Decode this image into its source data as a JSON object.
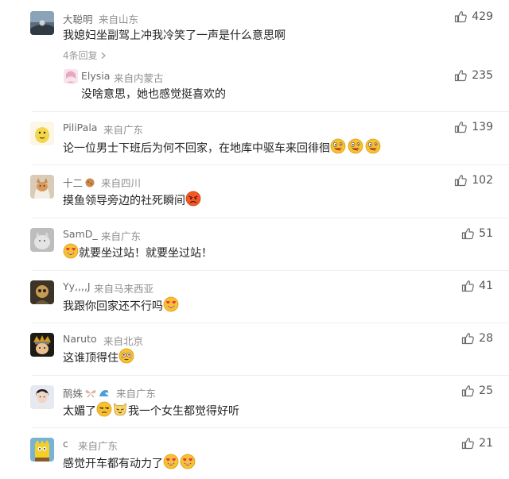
{
  "comments": [
    {
      "name": "大聪明",
      "location": "来自山东",
      "text": "我媳妇坐副驾上冲我冷笑了一声是什么意思啊",
      "likes": "429",
      "replies_label": "4条回复",
      "reply": {
        "name": "Elysia",
        "location": "来自内蒙古",
        "text": "没啥意思，她也感觉挺喜欢的",
        "likes": "235"
      }
    },
    {
      "name": "PiliPala",
      "location": "来自广东",
      "text": "论一位男士下班后为何不回家，在地库中驱车来回徘徊",
      "likes": "139"
    },
    {
      "name": "十二",
      "location": "来自四川",
      "text": "摸鱼领导旁边的社死瞬间",
      "likes": "102"
    },
    {
      "name": "SamD_",
      "location": "来自广东",
      "text": "就要坐过站！就要坐过站！",
      "likes": "51"
    },
    {
      "name": "Yy,,,,J",
      "location": "来自马来西亚",
      "text": "我跟你回家还不行吗",
      "likes": "41"
    },
    {
      "name": "Naruto",
      "location": "来自北京",
      "text": "这谁顶得住",
      "likes": "28"
    },
    {
      "name": "鸸姝",
      "location": "来自广东",
      "text_a": "太媚了",
      "text_b": "我一个女生都觉得好听",
      "likes": "25"
    },
    {
      "name": "c",
      "location": "来自广东",
      "text": "感觉开车都有动力了",
      "likes": "21"
    }
  ],
  "colors": {
    "name": "#6a6a6a",
    "text": "#222222",
    "meta": "#8f8f8f",
    "divider": "#efefef"
  },
  "icons": {
    "like": "thumb-up-icon",
    "chevron": "chevron-right-icon",
    "emoji_crazy": "zany-face-emoji",
    "emoji_angry": "angry-face-emoji",
    "emoji_heart_eyes": "heart-eyes-emoji",
    "emoji_flushed": "flushed-face-emoji",
    "emoji_unamused": "unamused-face-emoji",
    "emoji_cat": "cat-face-emoji"
  }
}
